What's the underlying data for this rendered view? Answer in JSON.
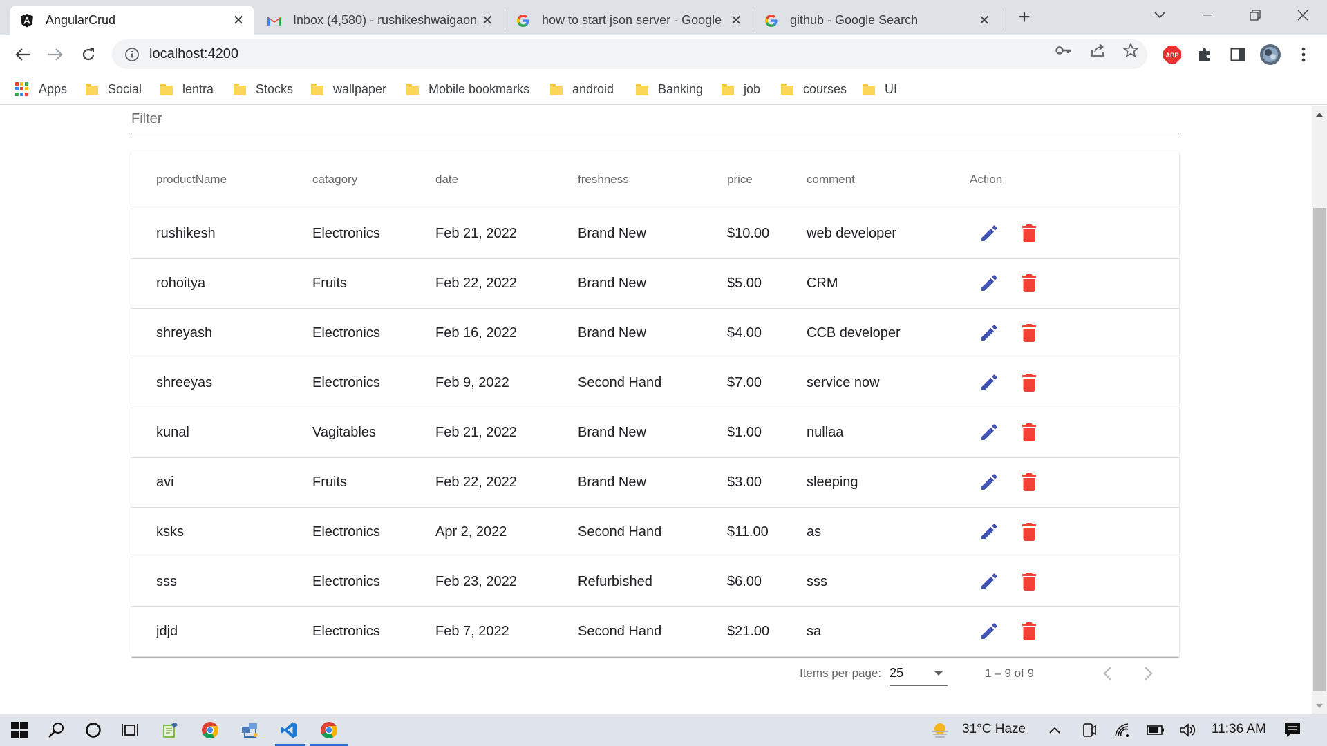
{
  "browser": {
    "tabs": [
      {
        "title": "AngularCrud",
        "icon": "angular-icon",
        "active": true
      },
      {
        "title": "Inbox (4,580) - rushikeshwaigaon",
        "icon": "gmail-icon",
        "active": false
      },
      {
        "title": "how to start json server - Google",
        "icon": "google-icon",
        "active": false
      },
      {
        "title": "github - Google Search",
        "icon": "google-icon",
        "active": false
      }
    ],
    "new_tab_label": "+",
    "address": "localhost:4200",
    "bookmarks": [
      {
        "label": "Apps",
        "icon": "apps-grid-icon"
      },
      {
        "label": "Social",
        "icon": "folder-icon"
      },
      {
        "label": "lentra",
        "icon": "folder-icon"
      },
      {
        "label": "Stocks",
        "icon": "folder-icon"
      },
      {
        "label": "wallpaper",
        "icon": "folder-icon"
      },
      {
        "label": "Mobile bookmarks",
        "icon": "folder-icon"
      },
      {
        "label": "android",
        "icon": "folder-icon"
      },
      {
        "label": "Banking",
        "icon": "folder-icon"
      },
      {
        "label": "job",
        "icon": "folder-icon"
      },
      {
        "label": "courses",
        "icon": "folder-icon"
      },
      {
        "label": "UI",
        "icon": "folder-icon"
      }
    ]
  },
  "filter": {
    "placeholder": "Filter",
    "value": ""
  },
  "table": {
    "columns": [
      "productName",
      "catagory",
      "date",
      "freshness",
      "price",
      "comment",
      "Action"
    ],
    "rows": [
      [
        "rushikesh",
        "Electronics",
        "Feb 21, 2022",
        "Brand New",
        "$10.00",
        "web developer"
      ],
      [
        "rohoitya",
        "Fruits",
        "Feb 22, 2022",
        "Brand New",
        "$5.00",
        "CRM"
      ],
      [
        "shreyash",
        "Electronics",
        "Feb 16, 2022",
        "Brand New",
        "$4.00",
        "CCB developer"
      ],
      [
        "shreeyas",
        "Electronics",
        "Feb 9, 2022",
        "Second Hand",
        "$7.00",
        "service now"
      ],
      [
        "kunal",
        "Vagitables",
        "Feb 21, 2022",
        "Brand New",
        "$1.00",
        "nullaa"
      ],
      [
        "avi",
        "Fruits",
        "Feb 22, 2022",
        "Brand New",
        "$3.00",
        "sleeping"
      ],
      [
        "ksks",
        "Electronics",
        "Apr 2, 2022",
        "Second Hand",
        "$11.00",
        "as"
      ],
      [
        "sss",
        "Electronics",
        "Feb 23, 2022",
        "Refurbished",
        "$6.00",
        "sss"
      ],
      [
        "jdjd",
        "Electronics",
        "Feb 7, 2022",
        "Second Hand",
        "$21.00",
        "sa"
      ]
    ],
    "action_icons": [
      "edit-icon",
      "delete-icon"
    ]
  },
  "paginator": {
    "items_per_page_label": "Items per page:",
    "page_size": "25",
    "range_label": "1 – 9 of 9"
  },
  "taskbar": {
    "weather": "31°C  Haze",
    "time": "11:36 AM"
  },
  "colors": {
    "edit_icon": "#3f51b5",
    "delete_icon": "#f44336",
    "tab_strip": "#dee1e6",
    "taskbar": "#dfe3ea"
  }
}
